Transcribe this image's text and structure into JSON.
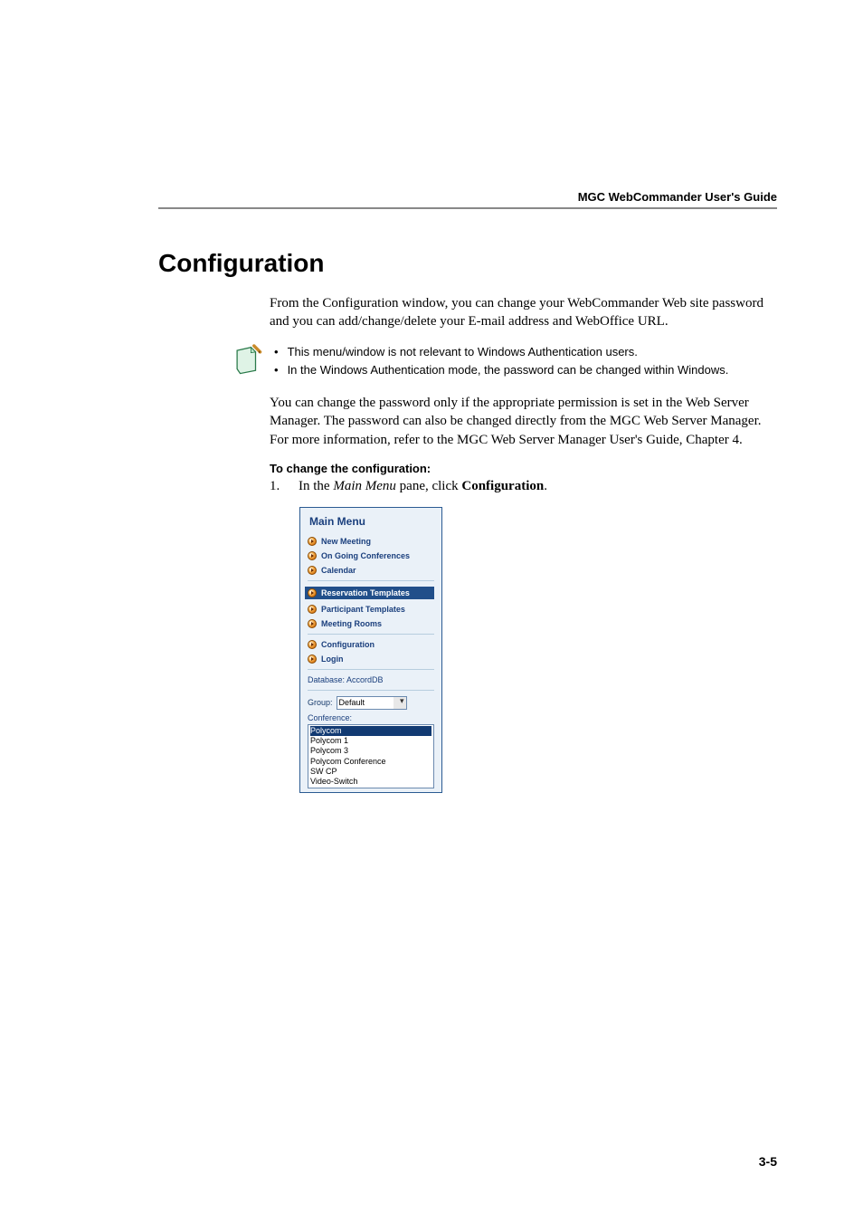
{
  "header": "MGC WebCommander User's Guide",
  "section_title": "Configuration",
  "para1": "From the Configuration window, you can change your WebCommander Web site password and you can add/change/delete your E-mail address and WebOffice URL.",
  "notes": {
    "item1": "This menu/window is not relevant to Windows Authentication users.",
    "item2": "In the Windows Authentication mode, the password can be changed within Windows."
  },
  "para2": "You can change the password only if the appropriate permission is set in the Web Server Manager. The password can also be changed directly from the MGC Web Server Manager. For more information, refer to the MGC Web Server Manager User's Guide, Chapter 4.",
  "subhead": "To change the configuration:",
  "step1_num": "1.",
  "step1_prefix": "In the ",
  "step1_em": "Main Menu",
  "step1_mid": " pane, click ",
  "step1_bold": "Configuration",
  "step1_suffix": ".",
  "menu": {
    "title": "Main Menu",
    "items": {
      "new_meeting": "New Meeting",
      "ongoing": "On Going Conferences",
      "calendar": "Calendar",
      "reservation": "Reservation Templates",
      "participant": "Participant Templates",
      "meeting_rooms": "Meeting Rooms",
      "configuration": "Configuration",
      "login": "Login"
    },
    "database_label": "Database:",
    "database_value": "AccordDB",
    "group_label": "Group:",
    "group_value": "Default",
    "conference_label": "Conference:",
    "conference_items": {
      "c0": "Polycom",
      "c1": "Polycom 1",
      "c2": "Polycom 3",
      "c3": "Polycom Conference",
      "c4": "SW CP",
      "c5": "Video-Switch"
    }
  },
  "page_number": "3-5"
}
